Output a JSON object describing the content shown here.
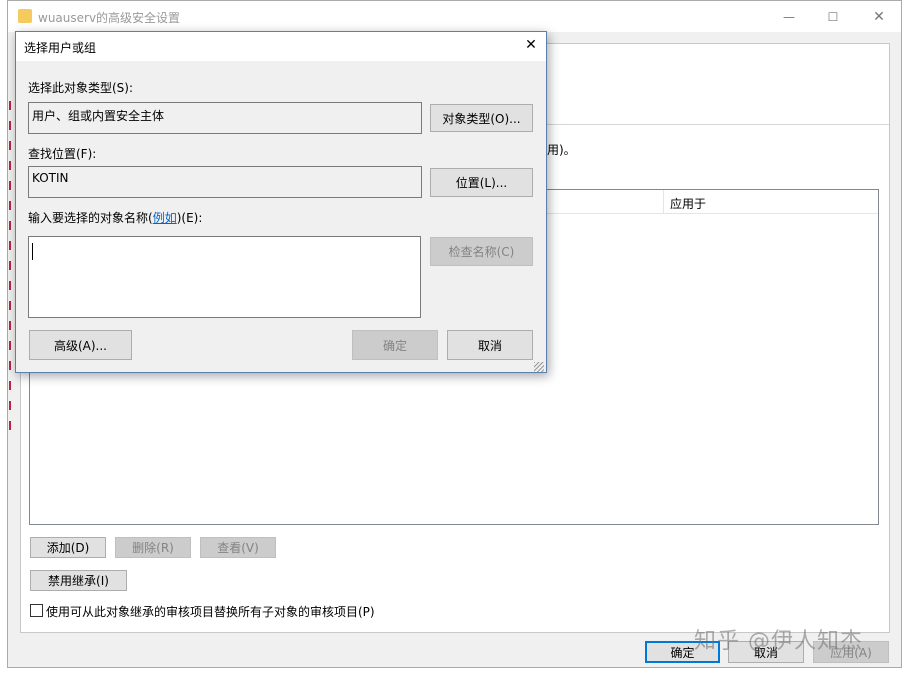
{
  "main_window": {
    "title": "wuauserv的高级安全设置",
    "controls": {
      "minimize": "—",
      "maximize": "☐",
      "close": "✕"
    },
    "partial_text_right": "用)。",
    "list_column_applies_to": "应用于",
    "buttons": {
      "add": "添加(D)",
      "remove": "删除(R)",
      "view": "查看(V)",
      "disable_inheritance": "禁用继承(I)",
      "ok": "确定",
      "cancel": "取消",
      "apply": "应用(A)"
    },
    "replace_checkbox_label": "使用可从此对象继承的审核项目替换所有子对象的审核项目(P)",
    "replace_checkbox_checked": false
  },
  "dialog": {
    "title": "选择用户或组",
    "close_glyph": "✕",
    "object_type_label": "选择此对象类型(S):",
    "object_type_value": "用户、组或内置安全主体",
    "object_type_button": "对象类型(O)...",
    "location_label": "查找位置(F):",
    "location_value": "KOTIN",
    "location_button": "位置(L)...",
    "names_label_prefix": "输入要选择的对象名称(",
    "names_label_link": "例如",
    "names_label_suffix": ")(E):",
    "names_value": "",
    "check_names_button": "检查名称(C)",
    "advanced_button": "高级(A)...",
    "ok_button": "确定",
    "cancel_button": "取消"
  },
  "watermark": "知乎 @伊人知杰",
  "colors": {
    "accent": "#0078d7",
    "dialog_bg": "#f0f0f0",
    "link": "#0066cc"
  }
}
